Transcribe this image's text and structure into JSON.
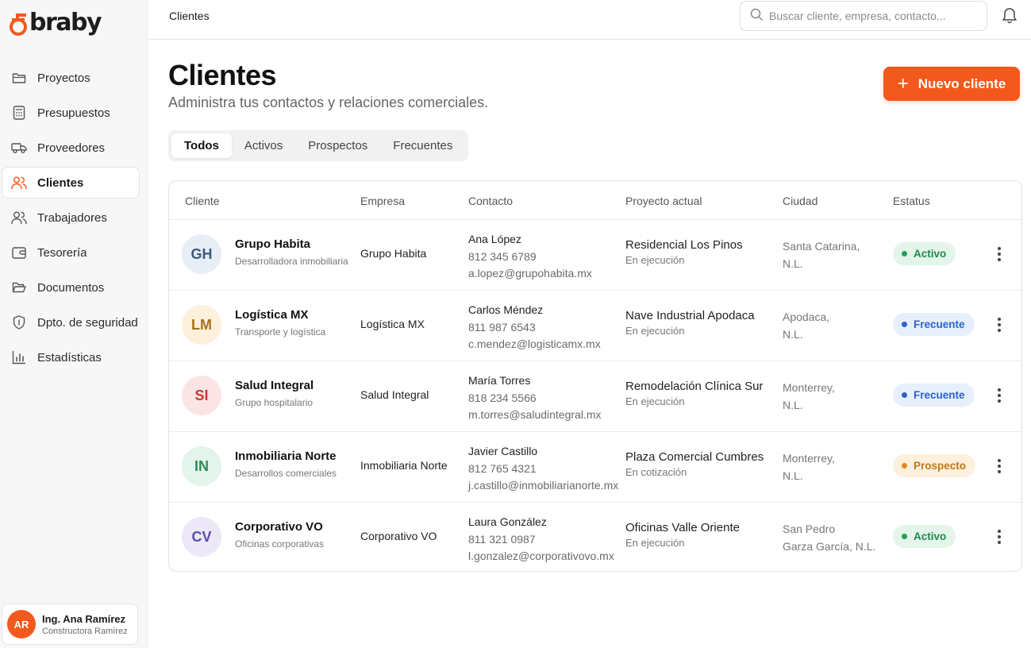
{
  "app": {
    "logo_text": "braby",
    "breadcrumb": "Clientes"
  },
  "search": {
    "placeholder": "Buscar cliente, empresa, contacto..."
  },
  "sidebar": {
    "items": [
      {
        "label": "Proyectos",
        "icon": "folder-icon"
      },
      {
        "label": "Presupuestos",
        "icon": "calculator-icon"
      },
      {
        "label": "Proveedores",
        "icon": "truck-icon"
      },
      {
        "label": "Clientes",
        "icon": "users-icon",
        "active": true
      },
      {
        "label": "Trabajadores",
        "icon": "user-group-icon"
      },
      {
        "label": "Tesorería",
        "icon": "wallet-icon"
      },
      {
        "label": "Documentos",
        "icon": "folder-open-icon"
      },
      {
        "label": "Dpto. de seguridad",
        "icon": "shield-icon"
      },
      {
        "label": "Estadísticas",
        "icon": "bar-chart-icon"
      }
    ]
  },
  "user": {
    "initials": "AR",
    "name": "Ing. Ana Ramírez",
    "company": "Constructora Ramírez"
  },
  "header": {
    "title": "Clientes",
    "subtitle": "Administra tus contactos y relaciones comerciales.",
    "new_button": "Nuevo cliente"
  },
  "tabs": [
    {
      "label": "Todos",
      "active": true
    },
    {
      "label": "Activos"
    },
    {
      "label": "Prospectos"
    },
    {
      "label": "Frecuentes"
    }
  ],
  "table": {
    "columns": [
      "Cliente",
      "Empresa",
      "Contacto",
      "Proyecto actual",
      "Ciudad",
      "Estatus"
    ],
    "rows": [
      {
        "initials": "GH",
        "name": "Grupo Habita",
        "type": "Desarrolladora inmobiliaria",
        "company": "Grupo Habita",
        "contact_name": "Ana López",
        "contact_phone": "812 345 6789",
        "contact_email": "a.lopez@grupohabita.mx",
        "project": "Residencial Los Pinos",
        "project_status": "En ejecución",
        "city_line1": "Santa Catarina,",
        "city_line2": "N.L.",
        "status": "Activo",
        "status_kind": "active",
        "avatar_bg": "#e8eef6",
        "avatar_fg": "#3d5a80"
      },
      {
        "initials": "LM",
        "name": "Logística MX",
        "type": "Transporte y logística",
        "company": "Logística MX",
        "contact_name": "Carlos Méndez",
        "contact_phone": "811 987 6543",
        "contact_email": "c.mendez@logisticamx.mx",
        "project": "Nave Industrial Apodaca",
        "project_status": "En ejecución",
        "city_line1": "Apodaca,",
        "city_line2": "N.L.",
        "status": "Frecuente",
        "status_kind": "frequent",
        "avatar_bg": "#fdf1dc",
        "avatar_fg": "#a8721a"
      },
      {
        "initials": "SI",
        "name": "Salud Integral",
        "type": "Grupo hospitalario",
        "company": "Salud Integral",
        "contact_name": "María Torres",
        "contact_phone": "818 234 5566",
        "contact_email": "m.torres@saludintegral.mx",
        "project": "Remodelación Clínica Sur",
        "project_status": "En ejecución",
        "city_line1": "Monterrey,",
        "city_line2": "N.L.",
        "status": "Frecuente",
        "status_kind": "frequent",
        "avatar_bg": "#fbe4e4",
        "avatar_fg": "#c43a3a"
      },
      {
        "initials": "IN",
        "name": "Inmobiliaria Norte",
        "type": "Desarrollos comerciales",
        "company": "Inmobiliaria Norte",
        "contact_name": "Javier Castillo",
        "contact_phone": "812 765 4321",
        "contact_email": "j.castillo@inmobiliarianorte.mx",
        "project": "Plaza Comercial Cumbres",
        "project_status": "En cotización",
        "city_line1": "Monterrey,",
        "city_line2": "N.L.",
        "status": "Prospecto",
        "status_kind": "prospect",
        "avatar_bg": "#e3f4ea",
        "avatar_fg": "#2f8a55"
      },
      {
        "initials": "CV",
        "name": "Corporativo VO",
        "type": "Oficinas corporativas",
        "company": "Corporativo VO",
        "contact_name": "Laura González",
        "contact_phone": "811 321 0987",
        "contact_email": "l.gonzalez@corporativovo.mx",
        "project": "Oficinas Valle Oriente",
        "project_status": "En ejecución",
        "city_line1": "San Pedro",
        "city_line2": "Garza García, N.L.",
        "status": "Activo",
        "status_kind": "active",
        "avatar_bg": "#ece8f8",
        "avatar_fg": "#5b4aa8"
      }
    ]
  },
  "colors": {
    "accent": "#f3591c",
    "active_bg": "#e4f5ea",
    "active_fg": "#1f8a4c",
    "active_dot": "#22a05a",
    "frequent_bg": "#e6effc",
    "frequent_fg": "#2d62c8",
    "frequent_dot": "#2d62c8",
    "prospect_bg": "#fdf0dc",
    "prospect_fg": "#c07716",
    "prospect_dot": "#e0891d"
  }
}
